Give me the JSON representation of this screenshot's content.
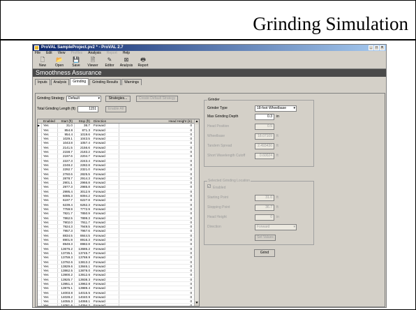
{
  "slide": {
    "title": "Grinding Simulation"
  },
  "window": {
    "title": "ProVAL SampleProject.pv2 * - ProVAL 2.7",
    "menus": [
      {
        "label": "File",
        "enabled": true
      },
      {
        "label": "Edit",
        "enabled": true
      },
      {
        "label": "View",
        "enabled": true
      },
      {
        "label": "Profiles",
        "enabled": false
      },
      {
        "label": "Analysis",
        "enabled": true
      },
      {
        "label": "Report",
        "enabled": false
      },
      {
        "label": "Help",
        "enabled": true
      }
    ],
    "toolbar": [
      {
        "label": "New",
        "icon": "new-icon",
        "glyph": "🗋"
      },
      {
        "label": "Open",
        "icon": "open-icon",
        "glyph": "📂"
      },
      {
        "label": "Save",
        "icon": "save-icon",
        "glyph": "💾"
      },
      {
        "label": "Viewer",
        "icon": "viewer-icon",
        "glyph": "🗎"
      },
      {
        "label": "Editor",
        "icon": "editor-icon",
        "glyph": "✎"
      },
      {
        "label": "Analysis",
        "icon": "analysis-icon",
        "glyph": "⊠"
      },
      {
        "label": "Report",
        "icon": "report-icon",
        "glyph": "🖶"
      }
    ],
    "banner": "Smoothness Assurance",
    "tabs": [
      {
        "label": "Inputs",
        "active": false
      },
      {
        "label": "Analysis",
        "active": false
      },
      {
        "label": "Grinding",
        "active": true
      },
      {
        "label": "Grinding Results",
        "active": false
      },
      {
        "label": "Warnings",
        "active": false
      }
    ]
  },
  "left": {
    "strategy_label": "Grinding Strategy",
    "strategy_value": "Default",
    "strategies_button": "Strategies...",
    "create_default_button": "Create Default Strategy",
    "total_length_label": "Total Grinding Length (ft)",
    "total_length_value": "1151",
    "enable_all_button": "Enable All",
    "columns": [
      "Enabled",
      "Start (ft)",
      "Stop (ft)",
      "Direction",
      "Head Height (in)"
    ],
    "rows": [
      [
        "Yes",
        "31.0",
        "36.7",
        "Forward",
        "0"
      ],
      [
        "Yes",
        "854.8",
        "871.3",
        "Forward",
        "0"
      ],
      [
        "Yes",
        "954.4",
        "1019.6",
        "Forward",
        "0"
      ],
      [
        "Yes",
        "1029.1",
        "1043.5",
        "Forward",
        "0"
      ],
      [
        "Yes",
        "1043.8",
        "1057.4",
        "Forward",
        "0"
      ],
      [
        "Yes",
        "2141.5",
        "2156.6",
        "Forward",
        "0"
      ],
      [
        "Yes",
        "2158.7",
        "2183.2",
        "Forward",
        "0"
      ],
      [
        "Yes",
        "2197.6",
        "2204.7",
        "Forward",
        "0"
      ],
      [
        "Yes",
        "2227.3",
        "2243.4",
        "Forward",
        "0"
      ],
      [
        "Yes",
        "2248.2",
        "2282.8",
        "Forward",
        "0"
      ],
      [
        "Yes",
        "2292.7",
        "2321.0",
        "Forward",
        "0"
      ],
      [
        "Yes",
        "2760.6",
        "2825.5",
        "Forward",
        "0"
      ],
      [
        "Yes",
        "2878.7",
        "2914.3",
        "Forward",
        "0"
      ],
      [
        "Yes",
        "2901.1",
        "2966.8",
        "Forward",
        "0"
      ],
      [
        "Yes",
        "2977.3",
        "2985.8",
        "Forward",
        "0"
      ],
      [
        "Yes",
        "2995.4",
        "3012.9",
        "Forward",
        "0"
      ],
      [
        "Yes",
        "6085.3",
        "6094.2",
        "Forward",
        "0"
      ],
      [
        "Yes",
        "6197.7",
        "6227.8",
        "Forward",
        "0"
      ],
      [
        "Yes",
        "6239.4",
        "6262.3",
        "Forward",
        "0"
      ],
      [
        "Yes",
        "7759.9",
        "7772.9",
        "Forward",
        "0"
      ],
      [
        "Yes",
        "7821.7",
        "7850.9",
        "Forward",
        "0"
      ],
      [
        "Yes",
        "7862.5",
        "7899.3",
        "Forward",
        "0"
      ],
      [
        "Yes",
        "7902.0",
        "7911.7",
        "Forward",
        "0"
      ],
      [
        "Yes",
        "7924.3",
        "7949.5",
        "Forward",
        "0"
      ],
      [
        "Yes",
        "7957.3",
        "7967.6",
        "Forward",
        "0"
      ],
      [
        "Yes",
        "8834.5",
        "8844.5",
        "Forward",
        "0"
      ],
      [
        "Yes",
        "8901.9",
        "8916.3",
        "Forward",
        "0"
      ],
      [
        "Yes",
        "8949.3",
        "8982.8",
        "Forward",
        "0"
      ],
      [
        "Yes",
        "13676.2",
        "13686.2",
        "Forward",
        "0"
      ],
      [
        "Yes",
        "13735.1",
        "13745.7",
        "Forward",
        "0"
      ],
      [
        "Yes",
        "13759.3",
        "13769.9",
        "Forward",
        "0"
      ],
      [
        "Yes",
        "13792.6",
        "13813.2",
        "Forward",
        "0"
      ],
      [
        "Yes",
        "13829.6",
        "13846.1",
        "Forward",
        "0"
      ],
      [
        "Yes",
        "13862.5",
        "13878.0",
        "Forward",
        "0"
      ],
      [
        "Yes",
        "13900.2",
        "13912.6",
        "Forward",
        "0"
      ],
      [
        "Yes",
        "13925.7",
        "13938.3",
        "Forward",
        "0"
      ],
      [
        "Yes",
        "13951.4",
        "13962.8",
        "Forward",
        "0"
      ],
      [
        "Yes",
        "13975.1",
        "13989.4",
        "Forward",
        "0"
      ],
      [
        "Yes",
        "14003.8",
        "14015.5",
        "Forward",
        "0"
      ],
      [
        "Yes",
        "14028.2",
        "14040.9",
        "Forward",
        "0"
      ],
      [
        "Yes",
        "14055.3",
        "14068.1",
        "Forward",
        "0"
      ],
      [
        "Yes",
        "14081.6",
        "14094.2",
        "Forward",
        "0"
      ]
    ]
  },
  "grinder": {
    "title": "Grinder",
    "type_label": "Grinder Type",
    "type_value": "18-foot Wheelbase",
    "depth_label": "Max Grinding Depth",
    "depth_value": "0.3",
    "depth_unit": "in",
    "head_position_label": "Head Position",
    "head_position_value": "0.5",
    "wheelbase_label": "Wheelbase",
    "wheelbase_value": "18.07109",
    "wheelbase_unit": "ft",
    "tandem_label": "Tandem Spread",
    "tandem_value": "2.493430",
    "tandem_unit": "ft",
    "cutoff_label": "Short Wavelength Cutoff",
    "cutoff_value": "0.60024",
    "cutoff_unit": "ft"
  },
  "location": {
    "title": "Selected Grinding Location",
    "enabled_label": "Enabled",
    "starting_label": "Starting Point",
    "starting_value": "31.0",
    "starting_unit": "ft",
    "stopping_label": "Stopping Point",
    "stopping_value": "36.7",
    "stopping_unit": "ft",
    "head_height_label": "Head Height",
    "head_height_value": "0",
    "head_height_unit": "in",
    "direction_label": "Direction",
    "direction_value": "Forward",
    "set_values_button": "Set Values"
  },
  "grind_button": "Grind"
}
